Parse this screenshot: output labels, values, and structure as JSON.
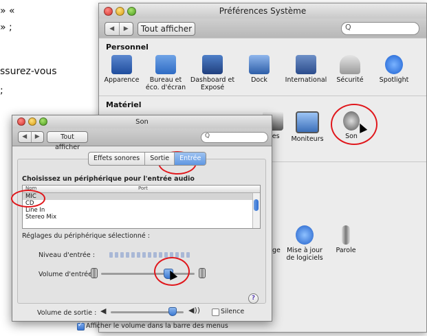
{
  "doc_text": {
    "line1": "» «",
    "line2": "» ;",
    "line3": "ssurez-vous",
    "line4": ";"
  },
  "back_window": {
    "title": "Préférences Système",
    "nav_glyphs": [
      "◀",
      "▶"
    ],
    "show_all": "Tout afficher",
    "search_glyph": "Q",
    "section_personal": "Personnel",
    "personal_items": [
      {
        "label": "Apparence",
        "icon": "appearance-icon"
      },
      {
        "label": "Bureau et\néco. d'écran",
        "icon": "desktop-icon"
      },
      {
        "label": "Dashboard et\nExposé",
        "icon": "dashboard-icon"
      },
      {
        "label": "Dock",
        "icon": "dock-icon"
      },
      {
        "label": "International",
        "icon": "international-icon"
      },
      {
        "label": "Sécurité",
        "icon": "security-icon"
      },
      {
        "label": "Spotlight",
        "icon": "spotlight-icon"
      }
    ],
    "section_hardware": "Matériel",
    "hardware_items": [
      {
        "label": "tes",
        "icon": "printer-icon"
      },
      {
        "label": "Moniteurs",
        "icon": "displays-icon"
      },
      {
        "label": "Son",
        "icon": "sound-icon"
      }
    ],
    "system_items": [
      {
        "label": "ge",
        "icon": "startup-icon"
      },
      {
        "label": "Mise à jour\nde logiciels",
        "icon": "software-update-icon"
      },
      {
        "label": "Parole",
        "icon": "speech-icon"
      }
    ]
  },
  "front_window": {
    "title": "Son",
    "nav_glyphs": [
      "◀",
      "▶"
    ],
    "show_all": "Tout afficher",
    "search_glyph": "Q",
    "tabs": [
      "Effets sonores",
      "Sortie",
      "Entrée"
    ],
    "active_tab": "Entrée",
    "choose_label": "Choisissez un périphérique pour l'entrée audio",
    "col_name": "Nom",
    "col_port": "Port",
    "devices": [
      "MIC",
      "CD",
      "Line In",
      "Stereo Mix"
    ],
    "selected_device": "MIC",
    "settings_label": "Réglages du périphérique sélectionné :",
    "input_level_label": "Niveau d'entrée :",
    "input_volume_label": "Volume d'entrée :",
    "input_volume_level": 0.72,
    "help": "?",
    "output_volume_label": "Volume de sortie :",
    "output_volume_level": 0.85,
    "mute_label": "Silence",
    "show_in_menubar_label": "Afficher le volume dans la barre des menus",
    "show_in_menubar_checked": true
  },
  "colors": {
    "highlight_ring": "#e0171c",
    "accent": "#3b79d3"
  }
}
